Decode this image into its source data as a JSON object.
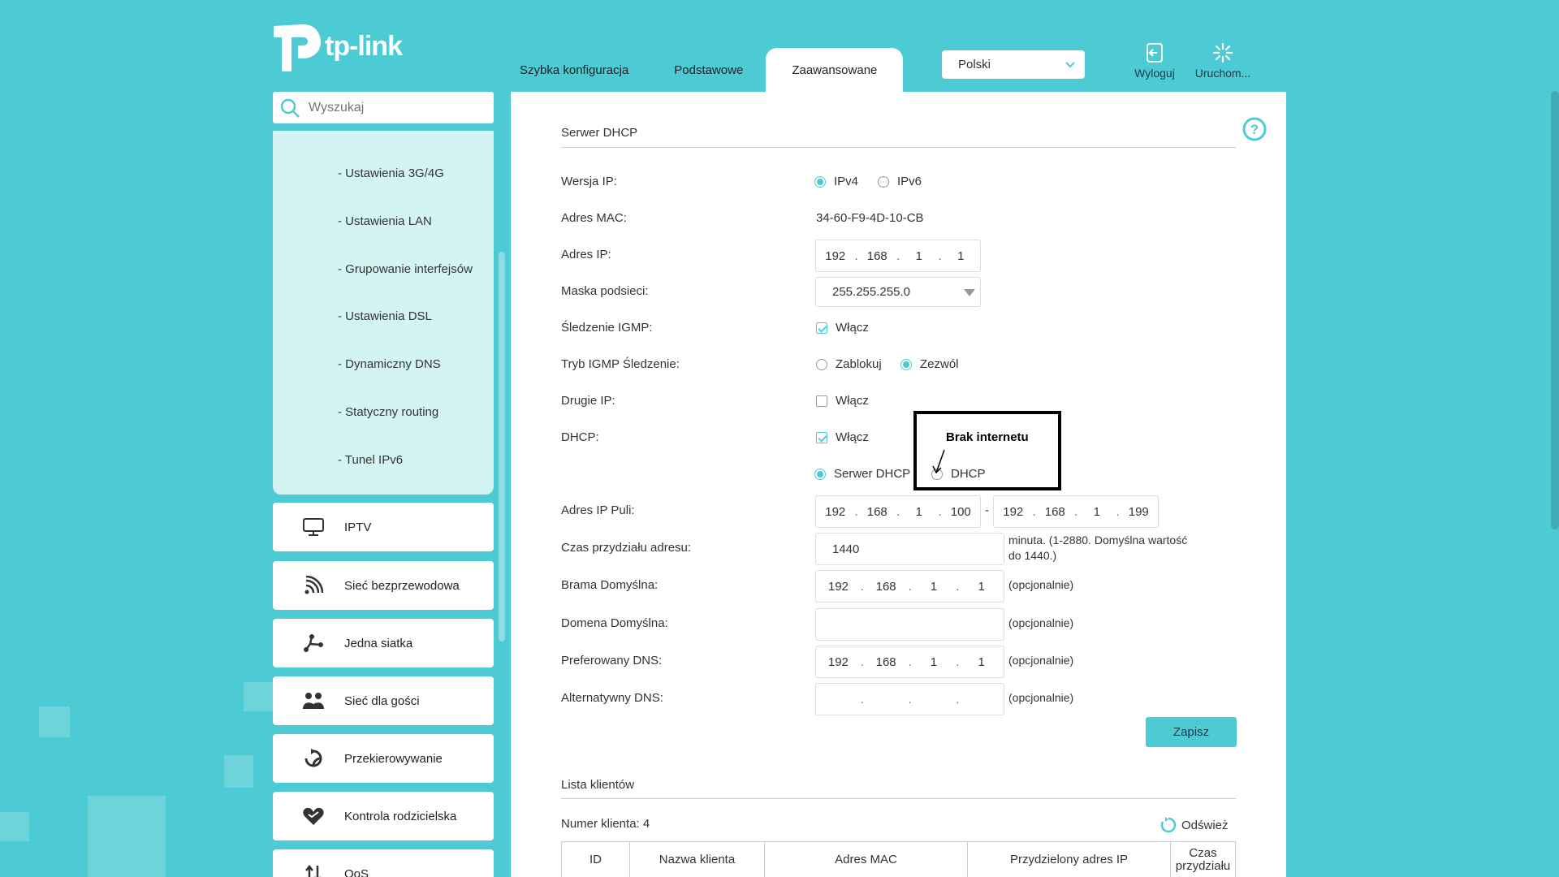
{
  "brand": {
    "logo_text": "tp-link"
  },
  "header": {
    "tabs": [
      {
        "label": "Szybka konfiguracja",
        "active": false
      },
      {
        "label": "Podstawowe",
        "active": false
      },
      {
        "label": "Zaawansowane",
        "active": true
      }
    ],
    "language": "Polski",
    "logout_label": "Wyloguj",
    "reboot_label": "Uruchom..."
  },
  "sidebar": {
    "search_placeholder": "Wyszukaj",
    "submenu": [
      "- Ustawienia 3G/4G",
      "- Ustawienia LAN",
      "- Grupowanie interfejsów",
      "- Ustawienia DSL",
      "- Dynamiczny DNS",
      "- Statyczny routing",
      "- Tunel IPv6"
    ],
    "menu": [
      {
        "label": "IPTV",
        "icon": "monitor-icon"
      },
      {
        "label": "Sieć bezprzewodowa",
        "icon": "wifi-icon"
      },
      {
        "label": "Jedna siatka",
        "icon": "mesh-icon"
      },
      {
        "label": "Sieć dla gości",
        "icon": "guests-icon"
      },
      {
        "label": "Przekierowywanie",
        "icon": "forwarding-icon"
      },
      {
        "label": "Kontrola rodzicielska",
        "icon": "heart-icon"
      },
      {
        "label": "QoS",
        "icon": "qos-icon"
      }
    ]
  },
  "dhcp": {
    "section_title": "Serwer DHCP",
    "ip_version_label": "Wersja IP:",
    "ipv4": "IPv4",
    "ipv6": "IPv6",
    "mac_label": "Adres MAC:",
    "mac_value": "34-60-F9-4D-10-CB",
    "ip_label": "Adres IP:",
    "ip": [
      "192",
      "168",
      "1",
      "1"
    ],
    "mask_label": "Maska podsieci:",
    "mask_value": "255.255.255.0",
    "igmp_label": "Śledzenie IGMP:",
    "enable": "Włącz",
    "igmp_mode_label": "Tryb IGMP Śledzenie:",
    "block": "Zablokuj",
    "allow": "Zezwól",
    "second_ip_label": "Drugie IP:",
    "dhcp_label": "DHCP:",
    "server_dhcp": "Serwer DHCP",
    "relay_dhcp": "DHCP",
    "pool_label": "Adres IP Puli:",
    "pool_start": [
      "192",
      "168",
      "1",
      "100"
    ],
    "pool_end": [
      "192",
      "168",
      "1",
      "199"
    ],
    "pool_sep": "-",
    "lease_label": "Czas przydziału adresu:",
    "lease_value": "1440",
    "lease_note_1": "minuta. (1-2880. Domyślna wartość",
    "lease_note_2": "do 1440.)",
    "gateway_label": "Brama Domyślna:",
    "gateway": [
      "192",
      "168",
      "1",
      "1"
    ],
    "optional": "(opcjonalnie)",
    "domain_label": "Domena Domyślna:",
    "domain_value": "",
    "pref_dns_label": "Preferowany DNS:",
    "pref_dns": [
      "192",
      "168",
      "1",
      "1"
    ],
    "alt_dns_label": "Alternatywny DNS:",
    "alt_dns": [
      "",
      "",
      "",
      ""
    ],
    "save": "Zapisz",
    "annotation": "Brak internetu"
  },
  "clients": {
    "section_title": "Lista klientów",
    "count_label": "Numer klienta: 4",
    "refresh": "Odśwież",
    "columns": [
      "ID",
      "Nazwa klienta",
      "Adres MAC",
      "Przydzielony adres IP",
      "Czas przydziału"
    ]
  },
  "colors": {
    "accent": "#4dcbd5",
    "background": "#4dcbd5"
  }
}
